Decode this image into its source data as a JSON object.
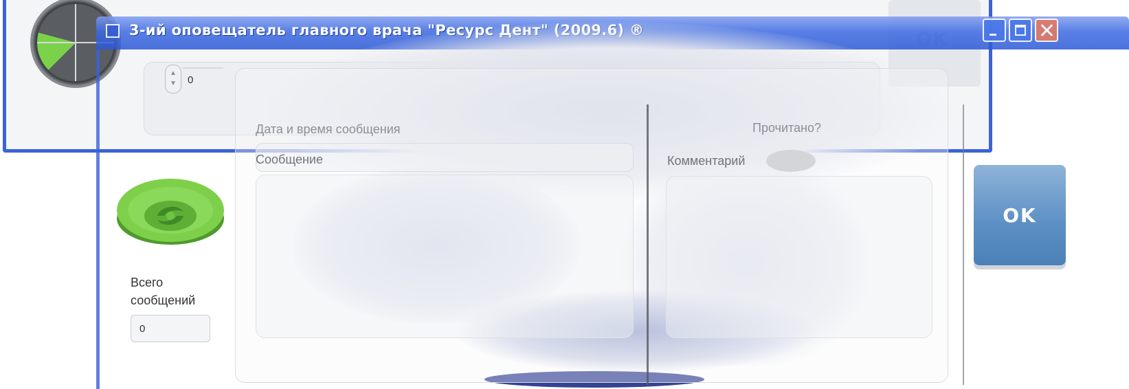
{
  "window": {
    "title": "3-ий оповещатель главного врача \"Ресурс Дент\"  (2009.6) ®"
  },
  "background_window": {
    "ok_label": "OK"
  },
  "form": {
    "counter_value": "0",
    "date_label": "Дата и время сообщения",
    "date_value": "",
    "read_label": "Прочитано?",
    "message_label": "Сообщение",
    "message_value": "",
    "comment_label": "Комментарий",
    "comment_value": "",
    "total_label_line1": "Всего",
    "total_label_line2": "сообщений",
    "total_value": "0",
    "ok_label": "OK"
  },
  "icons": [
    "clock-icon",
    "app-icon",
    "eye-icon",
    "minimize-icon",
    "maximize-icon",
    "close-icon"
  ],
  "colors": {
    "titlebar": "#2c59d6",
    "ok_button": "#5b8fc4",
    "eye_green": "#7ed04b"
  }
}
